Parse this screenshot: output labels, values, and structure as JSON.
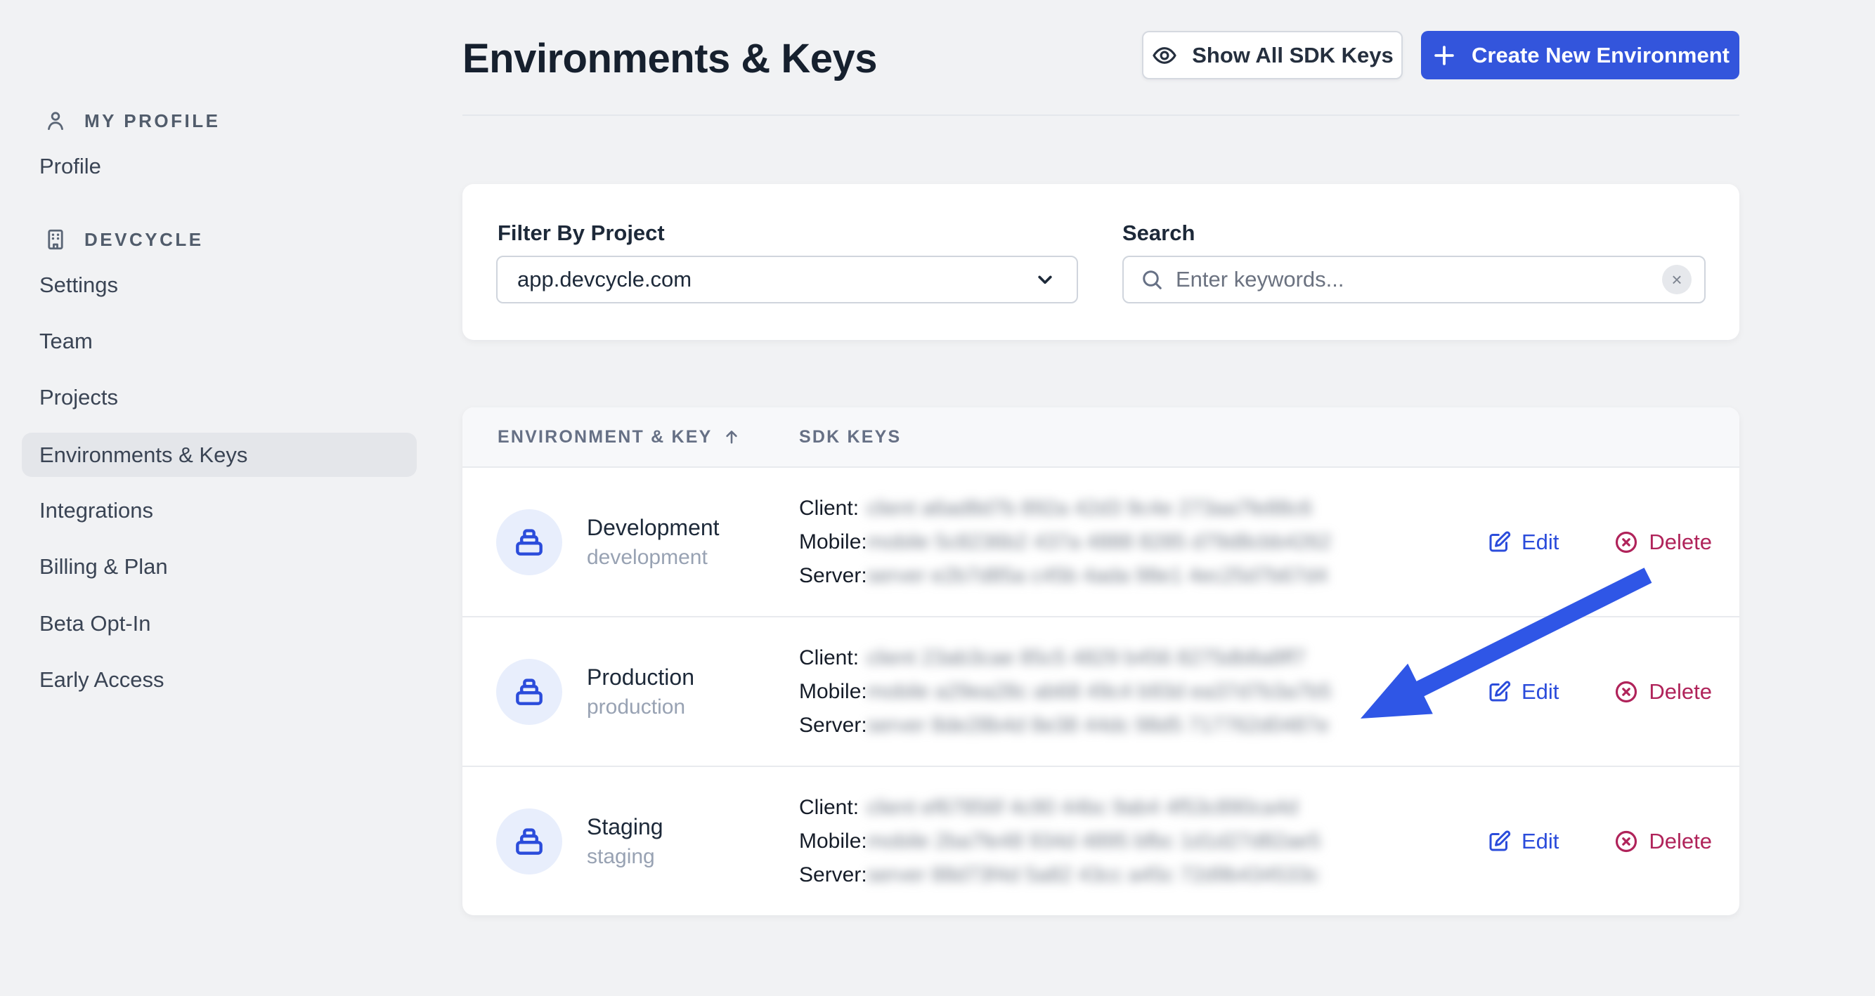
{
  "colors": {
    "accent_blue": "#3355DC",
    "icon_blue": "#2B4CDB",
    "delete_red": "#B0235A",
    "arrow_blue": "#2F56E6",
    "page_background": "#F1F2F4",
    "selected_pill": "#E4E6EA",
    "badge_background": "#E8EEFC"
  },
  "page_title": "Environments & Keys",
  "header": {
    "show_all_button": "Show All SDK Keys",
    "create_button": "Create New Environment"
  },
  "sidebar": {
    "sections": [
      {
        "header": "MY PROFILE",
        "icon": "user-icon",
        "items": [
          {
            "label": "Profile",
            "active": false
          }
        ]
      },
      {
        "header": "DEVCYCLE",
        "icon": "building-icon",
        "items": [
          {
            "label": "Settings",
            "active": false
          },
          {
            "label": "Team",
            "active": false
          },
          {
            "label": "Projects",
            "active": false
          },
          {
            "label": "Environments & Keys",
            "active": true
          },
          {
            "label": "Integrations",
            "active": false
          },
          {
            "label": "Billing & Plan",
            "active": false
          },
          {
            "label": "Beta Opt-In",
            "active": false
          },
          {
            "label": "Early Access",
            "active": false
          }
        ]
      }
    ]
  },
  "filters": {
    "project_label": "Filter By Project",
    "project_value": "app.devcycle.com",
    "search_label": "Search",
    "search_placeholder": "Enter keywords...",
    "clear_icon": "×"
  },
  "table": {
    "columns": {
      "env": "ENVIRONMENT & KEY",
      "sdk": "SDK KEYS"
    },
    "actions": {
      "edit": "Edit",
      "delete": "Delete"
    },
    "rows": [
      {
        "name": "Development",
        "key": "development",
        "sdk_keys": [
          {
            "label": "Client:",
            "masked_value": "client a6ad8d7b 892a 42d3 9c4e 273aa7fe88c6"
          },
          {
            "label": "Mobile:",
            "masked_value": "mobile 5c8236b2 437a 4888 8285 d79d8cbb4262"
          },
          {
            "label": "Server:",
            "masked_value": "server e2b7d85a c45b 4ada 98e1 4ec25d7b67d4"
          }
        ]
      },
      {
        "name": "Production",
        "key": "production",
        "sdk_keys": [
          {
            "label": "Client:",
            "masked_value": "client 23ab3cae 85c5 4829 b456 8275db8a8ff7"
          },
          {
            "label": "Mobile:",
            "masked_value": "mobile a29ea28c ab68 49c4 b93d ea37d7b3a7b5"
          },
          {
            "label": "Server:",
            "masked_value": "server 8de28b4d 8e38 44dc 98d5 717762d0487e"
          }
        ]
      },
      {
        "name": "Staging",
        "key": "staging",
        "sdk_keys": [
          {
            "label": "Client:",
            "masked_value": "client ef67856f 4c90 44bc 9ab4 4f53c890ca4d"
          },
          {
            "label": "Mobile:",
            "masked_value": "mobile 2ba7fe48 934d 4895 bfbc 1d1d27d82ae5"
          },
          {
            "label": "Server:",
            "masked_value": "server 88d73f4d 5a82 43cc a45c 72d9b434533c"
          }
        ]
      }
    ]
  }
}
